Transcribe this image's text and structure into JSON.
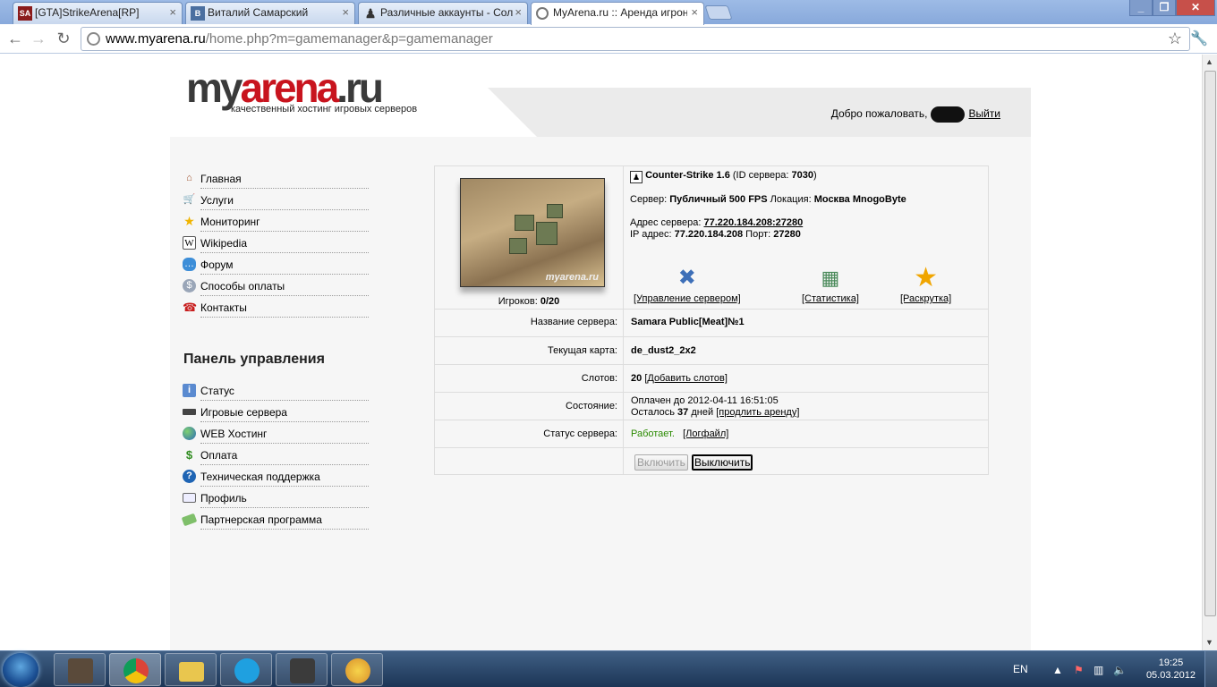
{
  "browser": {
    "tabs": [
      {
        "title": "[GTA]StrikeArena[RP]",
        "icon": "SA",
        "active": false
      },
      {
        "title": "Виталий Самарский",
        "icon": "B",
        "active": false
      },
      {
        "title": "Различные аккаунты - Сол",
        "icon": "pawn",
        "active": false
      },
      {
        "title": "MyArena.ru :: Аренда игрон",
        "icon": "globe",
        "active": true
      }
    ],
    "url_host": "www.myarena.ru",
    "url_path": "/home.php?m=gamemanager&p=gamemanager"
  },
  "site": {
    "logo": {
      "part1": "my",
      "part2": "arena",
      "part3": ".ru"
    },
    "tagline": "качественный хостинг игровых серверов",
    "welcome": "Добро пожаловать,",
    "logout": "Выйти",
    "menu": [
      {
        "label": "Главная",
        "icon": "home-icon"
      },
      {
        "label": "Услуги",
        "icon": "cart-icon"
      },
      {
        "label": "Мониторинг",
        "icon": "star-icon"
      },
      {
        "label": "Wikipedia",
        "icon": "wikipedia-icon"
      },
      {
        "label": "Форум",
        "icon": "chat-icon"
      },
      {
        "label": "Способы оплаты",
        "icon": "coins-icon"
      },
      {
        "label": "Контакты",
        "icon": "phone-icon"
      }
    ],
    "panel_title": "Панель управления",
    "panel_menu": [
      {
        "label": "Статус",
        "icon": "info-icon"
      },
      {
        "label": "Игровые сервера",
        "icon": "gun-icon"
      },
      {
        "label": "WEB Хостинг",
        "icon": "globe-icon"
      },
      {
        "label": "Оплата",
        "icon": "dollar-icon"
      },
      {
        "label": "Техническая поддержка",
        "icon": "help-icon"
      },
      {
        "label": "Профиль",
        "icon": "profile-card-icon"
      },
      {
        "label": "Партнерская программа",
        "icon": "money-icon"
      }
    ]
  },
  "server": {
    "game": "Counter-Strike 1.6",
    "id_prefix": "(ID сервера:",
    "id": "7030",
    "id_suffix": ")",
    "server_label": "Сервер:",
    "server_plan": "Публичный 500 FPS",
    "location_label": "Локация:",
    "location": "Москва MnogoByte",
    "address_label": "Адрес сервера:",
    "address": "77.220.184.208:27280",
    "ip_label": "IP адрес:",
    "ip": "77.220.184.208",
    "port_label": "Порт:",
    "port": "27280",
    "players_label": "Игроков:",
    "players": "0/20",
    "thumb_watermark": "myarena.ru",
    "actions": [
      {
        "label": "[Управление сервером]",
        "icon": "tools-icon"
      },
      {
        "label": "[Статистика]",
        "icon": "stats-icon"
      },
      {
        "label": "[Раскрутка]",
        "icon": "star-icon"
      }
    ],
    "name_label": "Название сервера:",
    "name": "Samara Public[Meat]№1",
    "map_label": "Текущая карта:",
    "map": "de_dust2_2x2",
    "slots_label": "Слотов:",
    "slots": "20",
    "add_slots": "[Добавить слотов]",
    "state_label": "Состояние:",
    "paid_until": "Оплачен до 2012-04-11 16:51:05",
    "remaining_prefix": "Осталось",
    "remaining_days": "37",
    "remaining_suffix": "дней",
    "extend": "[продлить аренду]",
    "status_label": "Статус сервера:",
    "status": "Работает.",
    "status_color": "#2a8a00",
    "logfile": "[Логфайл]",
    "btn_on": "Включить",
    "btn_off": "Выключить"
  },
  "taskbar": {
    "lang": "EN",
    "time": "19:25",
    "date": "05.03.2012"
  }
}
